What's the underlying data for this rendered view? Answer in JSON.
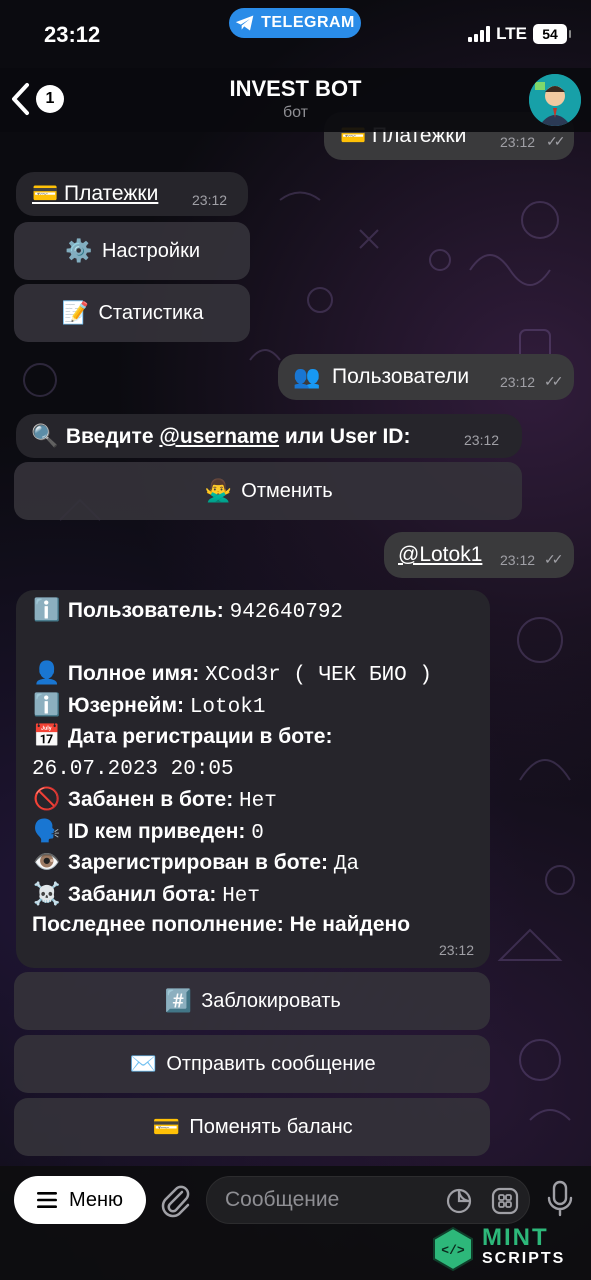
{
  "status_bar": {
    "time": "23:12",
    "pill_label": "TELEGRAM",
    "network": "LTE",
    "battery": "54"
  },
  "header": {
    "back_count": "1",
    "title": "INVEST BOT",
    "subtitle": "бот"
  },
  "messages": {
    "out_payments": {
      "text": "💳 Платежки",
      "time": "23:12"
    },
    "in_payments": {
      "text": "💳 Платежки",
      "time": "23:12"
    },
    "btn_settings": {
      "icon": "⚙️",
      "label": "Настройки"
    },
    "btn_stats": {
      "icon": "📝",
      "label": "Статистика"
    },
    "out_users": {
      "icon": "👥",
      "text": "Пользователи",
      "time": "23:12"
    },
    "prompt": {
      "icon": "🔍",
      "text_before": "Введите",
      "link": "@username",
      "text_after": "или User ID:",
      "time": "23:12"
    },
    "btn_cancel": {
      "icon": "🙅‍♂️",
      "label": "Отменить"
    },
    "out_username": {
      "text": "@Lotok1",
      "time": "23:12"
    },
    "user_info": {
      "user": {
        "icon": "ℹ️",
        "label": "Пользователь:",
        "value": "942640792"
      },
      "full_name": {
        "icon": "👤",
        "label": "Полное имя:",
        "value": "XCod3r ( ЧЕК БИО )"
      },
      "username": {
        "icon": "ℹ️",
        "label": "Юзернейм:",
        "value": "Lotok1"
      },
      "registration": {
        "icon": "📅",
        "label": "Дата регистрации в боте:",
        "value": "26.07.2023 20:05"
      },
      "banned": {
        "icon": "🚫",
        "label": "Забанен в боте:",
        "value": "Нет"
      },
      "referrer": {
        "icon": "🗣️",
        "label": "ID кем приведен:",
        "value": "0"
      },
      "registered": {
        "icon": "👁️",
        "label": "Зарегистрирован в боте:",
        "value": "Да"
      },
      "blocked_bot": {
        "icon": "☠️",
        "label": "Забанил бота:",
        "value": "Нет"
      },
      "last_topup": {
        "label": "Последнее пополнение:",
        "value": "Не найдено"
      },
      "time": "23:12"
    },
    "btn_block": {
      "icon": "#️⃣",
      "label": "Заблокировать"
    },
    "btn_send": {
      "icon": "✉️",
      "label": "Отправить сообщение"
    },
    "btn_balance": {
      "icon": "💳",
      "label": "Поменять баланс"
    }
  },
  "composer": {
    "menu_label": "Меню",
    "placeholder": "Сообщение"
  },
  "watermark": {
    "line1": "MINT",
    "line2": "SCRIPTS"
  },
  "colors": {
    "accent": "#2a8ce8",
    "bubble_out": "#3a3a3c",
    "bubble_in": "#26252b",
    "background": "#0b0b10"
  }
}
